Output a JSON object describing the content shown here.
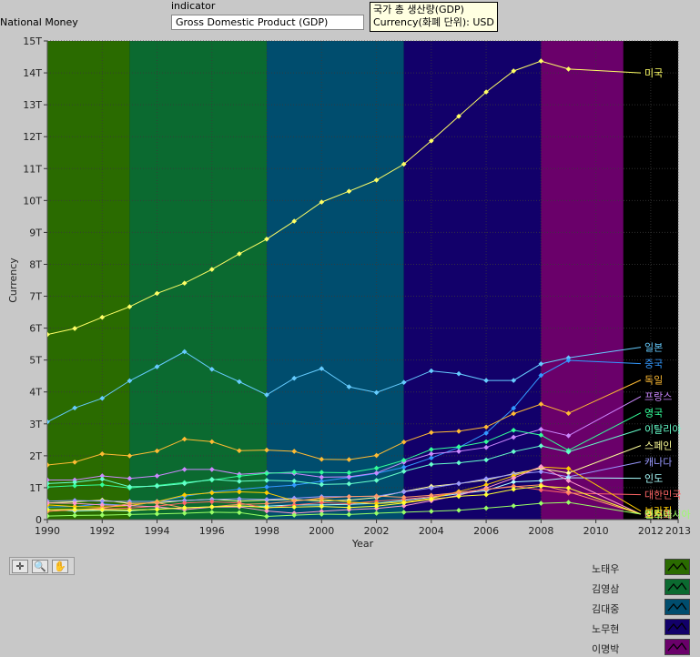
{
  "window": {
    "title": "National Money"
  },
  "indicator": {
    "caption": "indicator",
    "value": "Gross Domestic Product (GDP)"
  },
  "tooltip": {
    "line1": "국가 총 생산량(GDP)",
    "line2": "Currency(화폐 단위): USD"
  },
  "chart_data": {
    "type": "line",
    "xlabel": "Year",
    "ylabel": "Currency",
    "xlim": [
      1990,
      2013
    ],
    "ylim": [
      0,
      15
    ],
    "x_ticks": [
      1990,
      1992,
      1994,
      1996,
      1998,
      2000,
      2002,
      2004,
      2006,
      2008,
      2010,
      2012,
      2013
    ],
    "y_ticks": [
      "0",
      "1T",
      "2T",
      "3T",
      "4T",
      "5T",
      "6T",
      "7T",
      "8T",
      "9T",
      "10T",
      "11T",
      "12T",
      "13T",
      "14T",
      "15T"
    ],
    "y_unit": "trillion USD",
    "grid": true,
    "background_bands": [
      {
        "name": "노태우",
        "from": 1990,
        "to": 1993,
        "color": "#2a6b00"
      },
      {
        "name": "김영삼",
        "from": 1993,
        "to": 1998,
        "color": "#0b6a30"
      },
      {
        "name": "김대중",
        "from": 1998,
        "to": 2003,
        "color": "#004d6e"
      },
      {
        "name": "노무현",
        "from": 2003,
        "to": 2008,
        "color": "#12006a"
      },
      {
        "name": "이명박",
        "from": 2008,
        "to": 2011,
        "color": "#6a006a"
      }
    ],
    "x": [
      1990,
      1991,
      1992,
      1993,
      1994,
      1995,
      1996,
      1997,
      1998,
      1999,
      2000,
      2001,
      2002,
      2003,
      2004,
      2005,
      2006,
      2007,
      2008,
      2009
    ],
    "series": [
      {
        "name": "미국",
        "color": "#ffff66",
        "values": [
          5.8,
          5.99,
          6.34,
          6.67,
          7.09,
          7.41,
          7.84,
          8.33,
          8.79,
          9.35,
          9.95,
          10.29,
          10.64,
          11.14,
          11.87,
          12.64,
          13.4,
          14.06,
          14.37,
          14.12
        ]
      },
      {
        "name": "일본",
        "color": "#66ccff",
        "values": [
          3.06,
          3.5,
          3.8,
          4.35,
          4.79,
          5.26,
          4.71,
          4.32,
          3.91,
          4.43,
          4.73,
          4.16,
          3.98,
          4.3,
          4.66,
          4.57,
          4.36,
          4.36,
          4.88,
          5.07
        ]
      },
      {
        "name": "중국",
        "color": "#3399ff",
        "values": [
          0.39,
          0.41,
          0.49,
          0.44,
          0.56,
          0.73,
          0.86,
          0.95,
          1.02,
          1.08,
          1.2,
          1.32,
          1.45,
          1.64,
          1.93,
          2.26,
          2.71,
          3.49,
          4.52,
          4.99
        ]
      },
      {
        "name": "독일",
        "color": "#ffbb33",
        "values": [
          1.71,
          1.8,
          2.06,
          2.0,
          2.15,
          2.52,
          2.44,
          2.16,
          2.18,
          2.14,
          1.89,
          1.88,
          2.01,
          2.43,
          2.73,
          2.77,
          2.9,
          3.32,
          3.62,
          3.33
        ]
      },
      {
        "name": "프랑스",
        "color": "#cc88ff",
        "values": [
          1.24,
          1.24,
          1.37,
          1.29,
          1.37,
          1.57,
          1.57,
          1.42,
          1.47,
          1.45,
          1.33,
          1.34,
          1.46,
          1.8,
          2.06,
          2.14,
          2.26,
          2.58,
          2.83,
          2.63
        ]
      },
      {
        "name": "영국",
        "color": "#33ff99",
        "values": [
          1.02,
          1.06,
          1.09,
          0.99,
          1.07,
          1.16,
          1.24,
          1.36,
          1.45,
          1.49,
          1.48,
          1.47,
          1.61,
          1.86,
          2.2,
          2.28,
          2.44,
          2.8,
          2.65,
          2.17
        ]
      },
      {
        "name": "이탈리아",
        "color": "#66ffcc",
        "values": [
          1.13,
          1.17,
          1.27,
          1.03,
          1.05,
          1.13,
          1.26,
          1.2,
          1.23,
          1.21,
          1.1,
          1.12,
          1.23,
          1.51,
          1.73,
          1.78,
          1.87,
          2.13,
          2.31,
          2.12
        ]
      },
      {
        "name": "스페인",
        "color": "#ffff99",
        "values": [
          0.52,
          0.56,
          0.61,
          0.51,
          0.52,
          0.6,
          0.64,
          0.58,
          0.61,
          0.63,
          0.58,
          0.61,
          0.69,
          0.88,
          1.04,
          1.13,
          1.24,
          1.44,
          1.6,
          1.46
        ]
      },
      {
        "name": "캐나다",
        "color": "#9999ff",
        "values": [
          0.58,
          0.6,
          0.58,
          0.57,
          0.57,
          0.6,
          0.63,
          0.65,
          0.63,
          0.67,
          0.72,
          0.72,
          0.73,
          0.87,
          0.99,
          1.13,
          1.28,
          1.42,
          1.5,
          1.34
        ]
      },
      {
        "name": "인도",
        "color": "#aaffff",
        "values": [
          0.32,
          0.27,
          0.29,
          0.28,
          0.33,
          0.37,
          0.4,
          0.42,
          0.42,
          0.46,
          0.46,
          0.48,
          0.51,
          0.6,
          0.7,
          0.81,
          0.91,
          1.18,
          1.22,
          1.31
        ]
      },
      {
        "name": "대한민국",
        "color": "#ff6666",
        "values": [
          0.26,
          0.31,
          0.33,
          0.36,
          0.42,
          0.52,
          0.56,
          0.52,
          0.36,
          0.46,
          0.53,
          0.5,
          0.58,
          0.64,
          0.72,
          0.84,
          0.95,
          1.05,
          0.93,
          0.83
        ]
      },
      {
        "name": "브라질",
        "color": "#ffcc00",
        "values": [
          0.46,
          0.41,
          0.39,
          0.44,
          0.56,
          0.77,
          0.84,
          0.87,
          0.84,
          0.59,
          0.64,
          0.55,
          0.5,
          0.55,
          0.66,
          0.88,
          1.09,
          1.37,
          1.65,
          1.6
        ]
      },
      {
        "name": "러시아",
        "color": "#ff99cc",
        "values": [
          0.52,
          0.51,
          0.46,
          0.44,
          0.4,
          0.31,
          0.39,
          0.4,
          0.27,
          0.2,
          0.26,
          0.31,
          0.35,
          0.43,
          0.59,
          0.76,
          0.99,
          1.3,
          1.66,
          1.22
        ]
      },
      {
        "name": "멕시코",
        "color": "#ff9966",
        "values": [
          0.26,
          0.31,
          0.36,
          0.5,
          0.53,
          0.36,
          0.4,
          0.48,
          0.5,
          0.58,
          0.68,
          0.72,
          0.74,
          0.7,
          0.76,
          0.85,
          0.95,
          1.03,
          1.09,
          0.87
        ]
      },
      {
        "name": "호주",
        "color": "#ffff33",
        "values": [
          0.31,
          0.32,
          0.31,
          0.3,
          0.32,
          0.37,
          0.4,
          0.43,
          0.38,
          0.39,
          0.41,
          0.38,
          0.42,
          0.52,
          0.64,
          0.73,
          0.78,
          0.95,
          1.05,
          0.99
        ]
      },
      {
        "name": "인도네시아",
        "color": "#99ff66",
        "values": [
          0.11,
          0.13,
          0.14,
          0.16,
          0.18,
          0.2,
          0.23,
          0.22,
          0.1,
          0.14,
          0.17,
          0.16,
          0.2,
          0.23,
          0.26,
          0.29,
          0.36,
          0.43,
          0.51,
          0.54
        ]
      }
    ],
    "line_labels": [
      {
        "text": "미국",
        "color": "#ffff66"
      },
      {
        "text": "일본",
        "color": "#66ccff"
      },
      {
        "text": "중국",
        "color": "#3399ff"
      },
      {
        "text": "독일",
        "color": "#ffbb33"
      },
      {
        "text": "프랑스",
        "color": "#cc88ff"
      },
      {
        "text": "영국",
        "color": "#33ff99"
      },
      {
        "text": "이탈리아",
        "color": "#66ffcc"
      },
      {
        "text": "스페인",
        "color": "#ffff99"
      },
      {
        "text": "캐나다",
        "color": "#9999ff"
      },
      {
        "text": "인도",
        "color": "#aaffff"
      },
      {
        "text": "대한민국",
        "color": "#ff6666"
      },
      {
        "text": "브라질",
        "color": "#ffcc00"
      },
      {
        "text": "러시아",
        "color": "#ff99cc"
      },
      {
        "text": "멕시코",
        "color": "#ff9966"
      },
      {
        "text": "호주",
        "color": "#ffff33"
      },
      {
        "text": "인도네시아",
        "color": "#99ff66"
      }
    ]
  },
  "legend": {
    "items": [
      {
        "label": "노태우",
        "color": "#2a6b00"
      },
      {
        "label": "김영삼",
        "color": "#0b6a30"
      },
      {
        "label": "김대중",
        "color": "#004d6e"
      },
      {
        "label": "노무현",
        "color": "#12006a"
      },
      {
        "label": "이명박",
        "color": "#6a006a"
      }
    ]
  },
  "toolbar": {
    "icons": [
      "crosshair-icon",
      "zoom-icon",
      "pan-hand-icon"
    ]
  }
}
